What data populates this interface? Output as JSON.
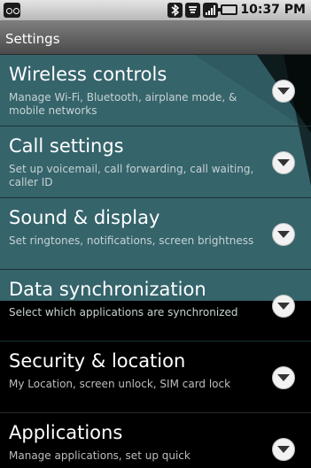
{
  "status_bar": {
    "time": "10:37 PM",
    "icons": [
      "notification-icon",
      "bluetooth-icon",
      "wifi-icon",
      "signal-icon",
      "battery-icon"
    ]
  },
  "title_bar": {
    "title": "Settings"
  },
  "settings_items": [
    {
      "title": "Wireless controls",
      "summary": "Manage Wi-Fi, Bluetooth, airplane mode, & mobile networks"
    },
    {
      "title": "Call settings",
      "summary": "Set up voicemail, call forwarding, call waiting, caller ID"
    },
    {
      "title": "Sound & display",
      "summary": "Set ringtones, notifications, screen brightness"
    },
    {
      "title": "Data synchronization",
      "summary": "Select which applications are synchronized"
    },
    {
      "title": "Security & location",
      "summary": "My Location, screen unlock, SIM card lock"
    },
    {
      "title": "Applications",
      "summary": "Manage applications, set up quick"
    }
  ],
  "colors": {
    "teal_background": "#2f5a61",
    "list_background": "#000000",
    "status_bar": "#d0d0d0"
  }
}
